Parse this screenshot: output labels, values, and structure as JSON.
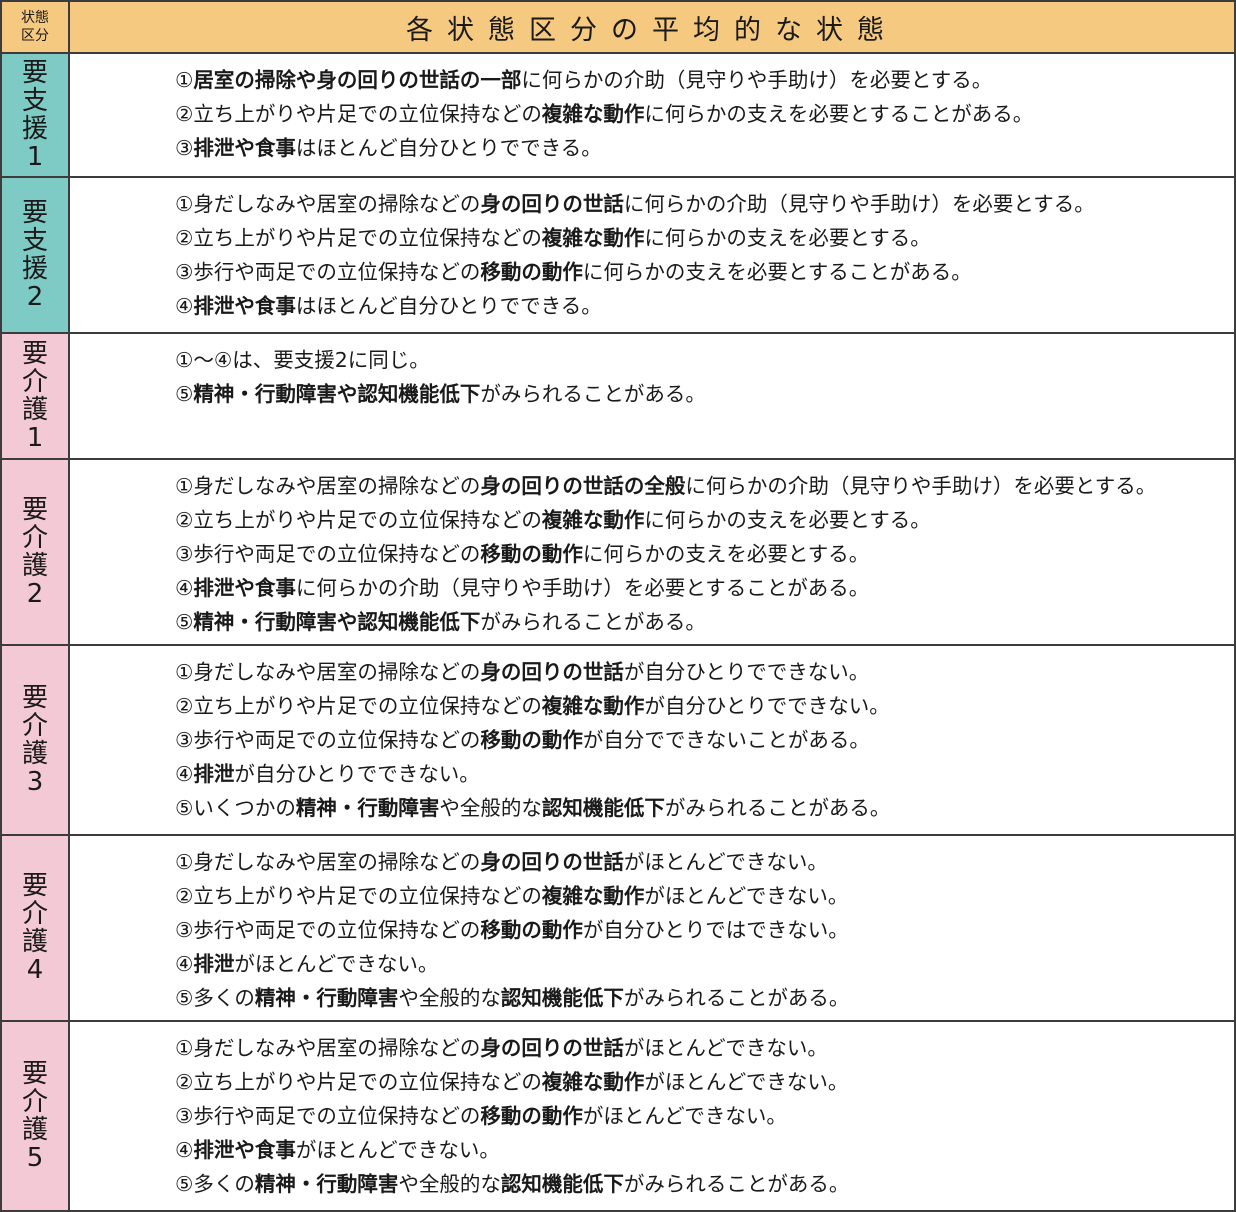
{
  "header": {
    "category_label_line1": "状態",
    "category_label_line2": "区分",
    "title": "各状態区分の平均的な状態"
  },
  "colors": {
    "header_bg": "#f5c97f",
    "support_bg": "#7ecac4",
    "care_bg": "#f3c9d5",
    "border": "#3c3c3c"
  },
  "rows": [
    {
      "level_chars": [
        "要",
        "支",
        "援",
        "1"
      ],
      "kind": "support",
      "lines": [
        [
          {
            "t": "①"
          },
          {
            "t": "居室の掃除や身の回りの世話の一部",
            "b": true
          },
          {
            "t": "に何らかの介助（見守りや手助け）を必要とする。"
          }
        ],
        [
          {
            "t": "②立ち上がりや片足での立位保持などの"
          },
          {
            "t": "複雑な動作",
            "b": true
          },
          {
            "t": "に何らかの支えを必要とすることがある。"
          }
        ],
        [
          {
            "t": "③"
          },
          {
            "t": "排泄や食事",
            "b": true
          },
          {
            "t": "はほとんど自分ひとりでできる。"
          }
        ]
      ]
    },
    {
      "level_chars": [
        "要",
        "支",
        "援",
        "2"
      ],
      "kind": "support",
      "lines": [
        [
          {
            "t": "①身だしなみや居室の掃除などの"
          },
          {
            "t": "身の回りの世話",
            "b": true
          },
          {
            "t": "に何らかの介助（見守りや手助け）を必要とする。"
          }
        ],
        [
          {
            "t": "②立ち上がりや片足での立位保持などの"
          },
          {
            "t": "複雑な動作",
            "b": true
          },
          {
            "t": "に何らかの支えを必要とする。"
          }
        ],
        [
          {
            "t": "③歩行や両足での立位保持などの"
          },
          {
            "t": "移動の動作",
            "b": true
          },
          {
            "t": "に何らかの支えを必要とすることがある。"
          }
        ],
        [
          {
            "t": "④"
          },
          {
            "t": "排泄や食事",
            "b": true
          },
          {
            "t": "はほとんど自分ひとりでできる。"
          }
        ]
      ]
    },
    {
      "level_chars": [
        "要",
        "介",
        "護",
        "1"
      ],
      "kind": "care",
      "lines": [
        [
          {
            "t": "①～④は、要支援2に同じ。"
          }
        ],
        [
          {
            "t": "⑤"
          },
          {
            "t": "精神・行動障害や認知機能低下",
            "b": true
          },
          {
            "t": "がみられることがある。"
          }
        ]
      ]
    },
    {
      "level_chars": [
        "要",
        "介",
        "護",
        "2"
      ],
      "kind": "care",
      "lines": [
        [
          {
            "t": "①身だしなみや居室の掃除などの"
          },
          {
            "t": "身の回りの世話の全般",
            "b": true
          },
          {
            "t": "に何らかの介助（見守りや手助け）を必要とする。"
          }
        ],
        [
          {
            "t": "②立ち上がりや片足での立位保持などの"
          },
          {
            "t": "複雑な動作",
            "b": true
          },
          {
            "t": "に何らかの支えを必要とする。"
          }
        ],
        [
          {
            "t": "③歩行や両足での立位保持などの"
          },
          {
            "t": "移動の動作",
            "b": true
          },
          {
            "t": "に何らかの支えを必要とする。"
          }
        ],
        [
          {
            "t": "④"
          },
          {
            "t": "排泄や食事",
            "b": true
          },
          {
            "t": "に何らかの介助（見守りや手助け）を必要とすることがある。"
          }
        ],
        [
          {
            "t": "⑤"
          },
          {
            "t": "精神・行動障害や認知機能低下",
            "b": true
          },
          {
            "t": "がみられることがある。"
          }
        ]
      ]
    },
    {
      "level_chars": [
        "要",
        "介",
        "護",
        "3"
      ],
      "kind": "care",
      "lines": [
        [
          {
            "t": "①身だしなみや居室の掃除などの"
          },
          {
            "t": "身の回りの世話",
            "b": true
          },
          {
            "t": "が自分ひとりでできない。"
          }
        ],
        [
          {
            "t": "②立ち上がりや片足での立位保持などの"
          },
          {
            "t": "複雑な動作",
            "b": true
          },
          {
            "t": "が自分ひとりでできない。"
          }
        ],
        [
          {
            "t": "③歩行や両足での立位保持などの"
          },
          {
            "t": "移動の動作",
            "b": true
          },
          {
            "t": "が自分でできないことがある。"
          }
        ],
        [
          {
            "t": "④"
          },
          {
            "t": "排泄",
            "b": true
          },
          {
            "t": "が自分ひとりでできない。"
          }
        ],
        [
          {
            "t": "⑤いくつかの"
          },
          {
            "t": "精神・行動障害",
            "b": true
          },
          {
            "t": "や全般的な"
          },
          {
            "t": "認知機能低下",
            "b": true
          },
          {
            "t": "がみられることがある。"
          }
        ]
      ]
    },
    {
      "level_chars": [
        "要",
        "介",
        "護",
        "4"
      ],
      "kind": "care",
      "lines": [
        [
          {
            "t": "①身だしなみや居室の掃除などの"
          },
          {
            "t": "身の回りの世話",
            "b": true
          },
          {
            "t": "がほとんどできない。"
          }
        ],
        [
          {
            "t": "②立ち上がりや片足での立位保持などの"
          },
          {
            "t": "複雑な動作",
            "b": true
          },
          {
            "t": "がほとんどできない。"
          }
        ],
        [
          {
            "t": "③歩行や両足での立位保持などの"
          },
          {
            "t": "移動の動作",
            "b": true
          },
          {
            "t": "が自分ひとりではできない。"
          }
        ],
        [
          {
            "t": "④"
          },
          {
            "t": "排泄",
            "b": true
          },
          {
            "t": "がほとんどできない。"
          }
        ],
        [
          {
            "t": "⑤多くの"
          },
          {
            "t": "精神・行動障害",
            "b": true
          },
          {
            "t": "や全般的な"
          },
          {
            "t": "認知機能低下",
            "b": true
          },
          {
            "t": "がみられることがある。"
          }
        ]
      ]
    },
    {
      "level_chars": [
        "要",
        "介",
        "護",
        "5"
      ],
      "kind": "care",
      "lines": [
        [
          {
            "t": "①身だしなみや居室の掃除などの"
          },
          {
            "t": "身の回りの世話",
            "b": true
          },
          {
            "t": "がほとんどできない。"
          }
        ],
        [
          {
            "t": "②立ち上がりや片足での立位保持などの"
          },
          {
            "t": "複雑な動作",
            "b": true
          },
          {
            "t": "がほとんどできない。"
          }
        ],
        [
          {
            "t": "③歩行や両足での立位保持などの"
          },
          {
            "t": "移動の動作",
            "b": true
          },
          {
            "t": "がほとんどできない。"
          }
        ],
        [
          {
            "t": "④"
          },
          {
            "t": "排泄や食事",
            "b": true
          },
          {
            "t": "がほとんどできない。"
          }
        ],
        [
          {
            "t": "⑤多くの"
          },
          {
            "t": "精神・行動障害",
            "b": true
          },
          {
            "t": "や全般的な"
          },
          {
            "t": "認知機能低下",
            "b": true
          },
          {
            "t": "がみられることがある。"
          }
        ]
      ]
    }
  ]
}
